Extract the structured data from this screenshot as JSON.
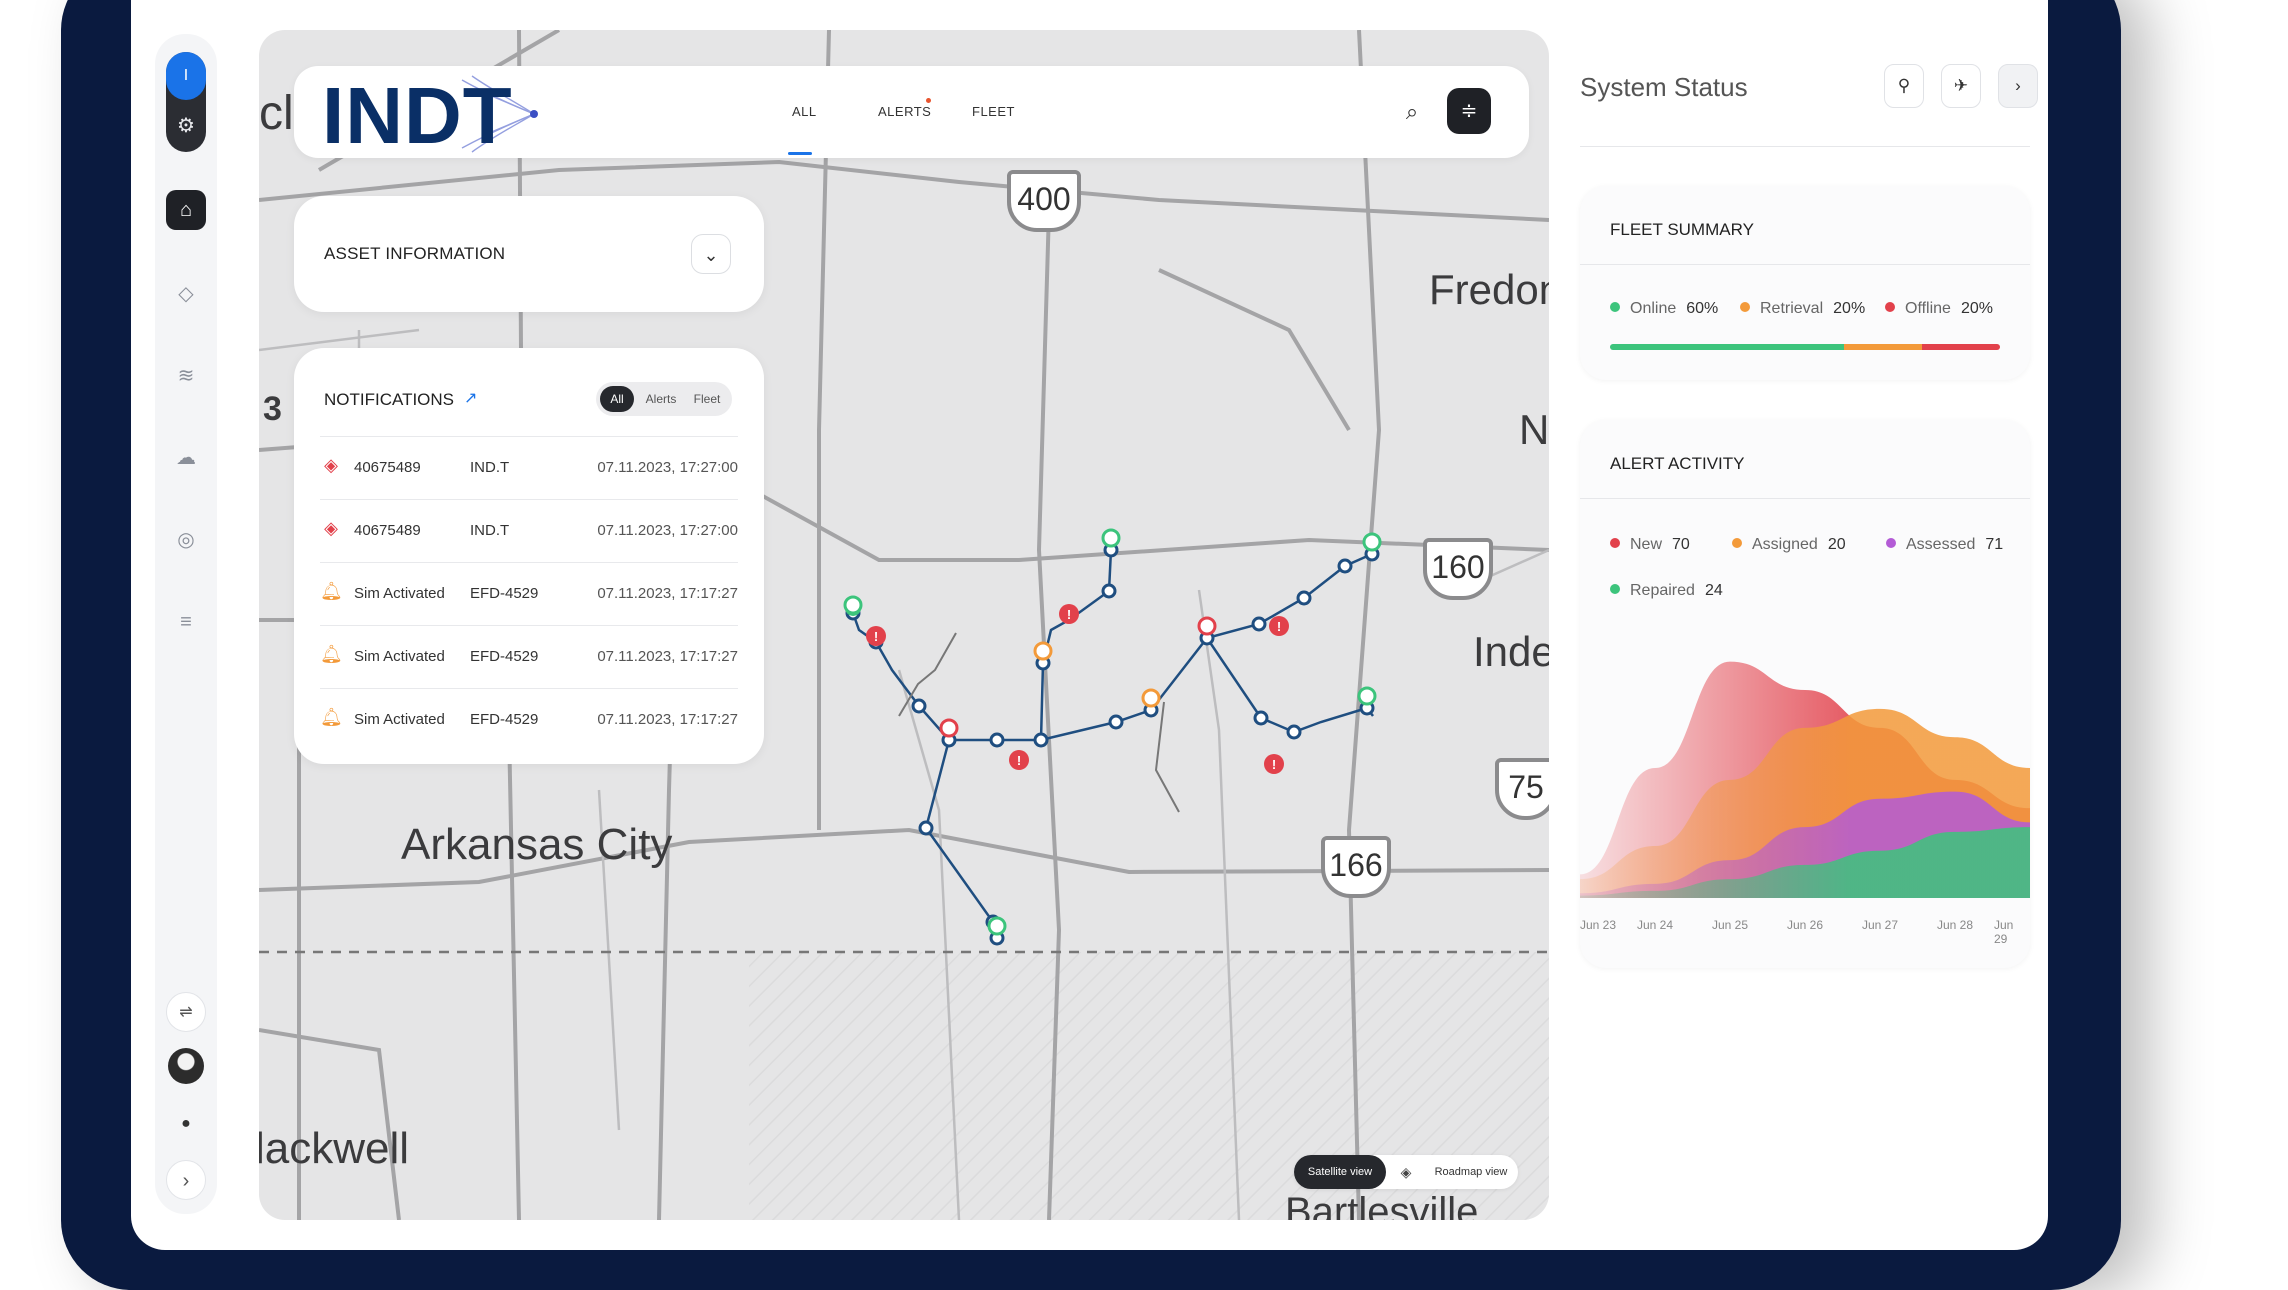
{
  "sidebar": {
    "user_initial": "I",
    "icons": [
      "settings-icon",
      "home-icon",
      "diamond-icon",
      "waves-icon",
      "cloud-icon",
      "target-icon",
      "layers-icon",
      "sliders-icon",
      "chat-icon",
      "chevron-right-icon"
    ]
  },
  "map": {
    "labels": {
      "fredonia": "Fredon",
      "arkansas_city": "Arkansas City",
      "independence": "Inde",
      "blackwell": "lackwell",
      "bartlesville": "Bartlesville",
      "top_left": "cl",
      "right_n": "N",
      "left_3": "3"
    },
    "highways": [
      "400",
      "160",
      "166",
      "75"
    ],
    "view_toggle": {
      "satellite": "Satellite view",
      "roadmap": "Roadmap view"
    }
  },
  "topbar": {
    "logo_text": "INDT",
    "tabs": [
      {
        "label": "ALL",
        "active": true
      },
      {
        "label": "ALERTS",
        "has_dot": true
      },
      {
        "label": "FLEET"
      }
    ]
  },
  "asset_info": {
    "title": "ASSET INFORMATION"
  },
  "notifications": {
    "title": "NOTIFICATIONS",
    "filters": [
      "All",
      "Alerts",
      "Fleet"
    ],
    "active_filter": "All",
    "rows": [
      {
        "icon": "alert-diamond-icon",
        "name": "40675489",
        "source": "IND.T",
        "time": "07.11.2023, 17:27:00"
      },
      {
        "icon": "alert-diamond-icon",
        "name": "40675489",
        "source": "IND.T",
        "time": "07.11.2023, 17:27:00"
      },
      {
        "icon": "bell-icon",
        "name": "Sim Activated",
        "source": "EFD-4529",
        "time": "07.11.2023, 17:17:27"
      },
      {
        "icon": "bell-icon",
        "name": "Sim Activated",
        "source": "EFD-4529",
        "time": "07.11.2023, 17:17:27"
      },
      {
        "icon": "bell-icon",
        "name": "Sim Activated",
        "source": "EFD-4529",
        "time": "07.11.2023, 17:17:27"
      }
    ]
  },
  "system_status": {
    "title": "System Status",
    "fleet_summary": {
      "title": "FLEET SUMMARY",
      "items": [
        {
          "label": "Online",
          "value": "60%",
          "fraction": 0.6,
          "color": "#3cc47c"
        },
        {
          "label": "Retrieval",
          "value": "20%",
          "fraction": 0.2,
          "color": "#f39a3a"
        },
        {
          "label": "Offline",
          "value": "20%",
          "fraction": 0.2,
          "color": "#e2414b"
        }
      ]
    },
    "alert_activity": {
      "title": "ALERT ACTIVITY",
      "legend": [
        {
          "label": "New",
          "value": "70",
          "color": "#e2414b"
        },
        {
          "label": "Assigned",
          "value": "20",
          "color": "#f39a3a"
        },
        {
          "label": "Assessed",
          "value": "71",
          "color": "#b35bd6"
        },
        {
          "label": "Repaired",
          "value": "24",
          "color": "#3cc47c"
        }
      ],
      "x_labels": [
        "Jun 23",
        "Jun 24",
        "Jun 25",
        "Jun 26",
        "Jun 27",
        "Jun 28",
        "Jun 29"
      ]
    }
  },
  "chart_data": {
    "type": "area",
    "categories": [
      "Jun 23",
      "Jun 24",
      "Jun 25",
      "Jun 26",
      "Jun 27",
      "Jun 28",
      "Jun 29"
    ],
    "series": [
      {
        "name": "New",
        "values": [
          10,
          55,
          100,
          88,
          72,
          50,
          38
        ]
      },
      {
        "name": "Assigned",
        "values": [
          8,
          22,
          50,
          72,
          80,
          68,
          55
        ]
      },
      {
        "name": "Assessed",
        "values": [
          2,
          6,
          16,
          30,
          42,
          45,
          32
        ]
      },
      {
        "name": "Repaired",
        "values": [
          1,
          3,
          8,
          14,
          20,
          28,
          30
        ]
      }
    ],
    "ylim": [
      0,
      110
    ],
    "grid": false
  }
}
